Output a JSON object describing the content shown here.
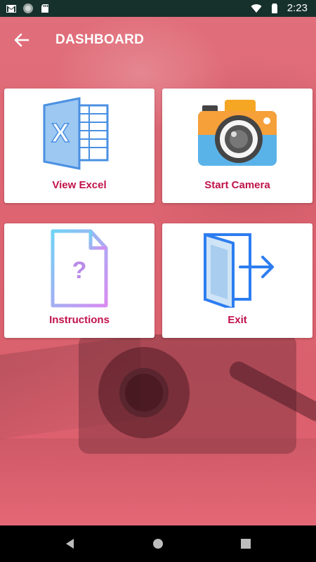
{
  "status_bar": {
    "time": "2:23",
    "icons": [
      "gmail-icon",
      "circle-app-icon",
      "sd-card-icon",
      "wifi-icon",
      "battery-icon"
    ]
  },
  "app_bar": {
    "title": "DASHBOARD",
    "back_icon": "arrow-back-icon"
  },
  "cards": [
    {
      "label": "View Excel",
      "icon": "excel-icon"
    },
    {
      "label": "Start Camera",
      "icon": "camera-icon"
    },
    {
      "label": "Instructions",
      "icon": "help-document-icon"
    },
    {
      "label": "Exit",
      "icon": "exit-door-icon"
    }
  ],
  "nav_bar": {
    "buttons": [
      "back-triangle-icon",
      "home-circle-icon",
      "recents-square-icon"
    ]
  },
  "colors": {
    "accent_label": "#c0134a",
    "overlay": "#e0606e",
    "status_bar": "#16302b"
  }
}
